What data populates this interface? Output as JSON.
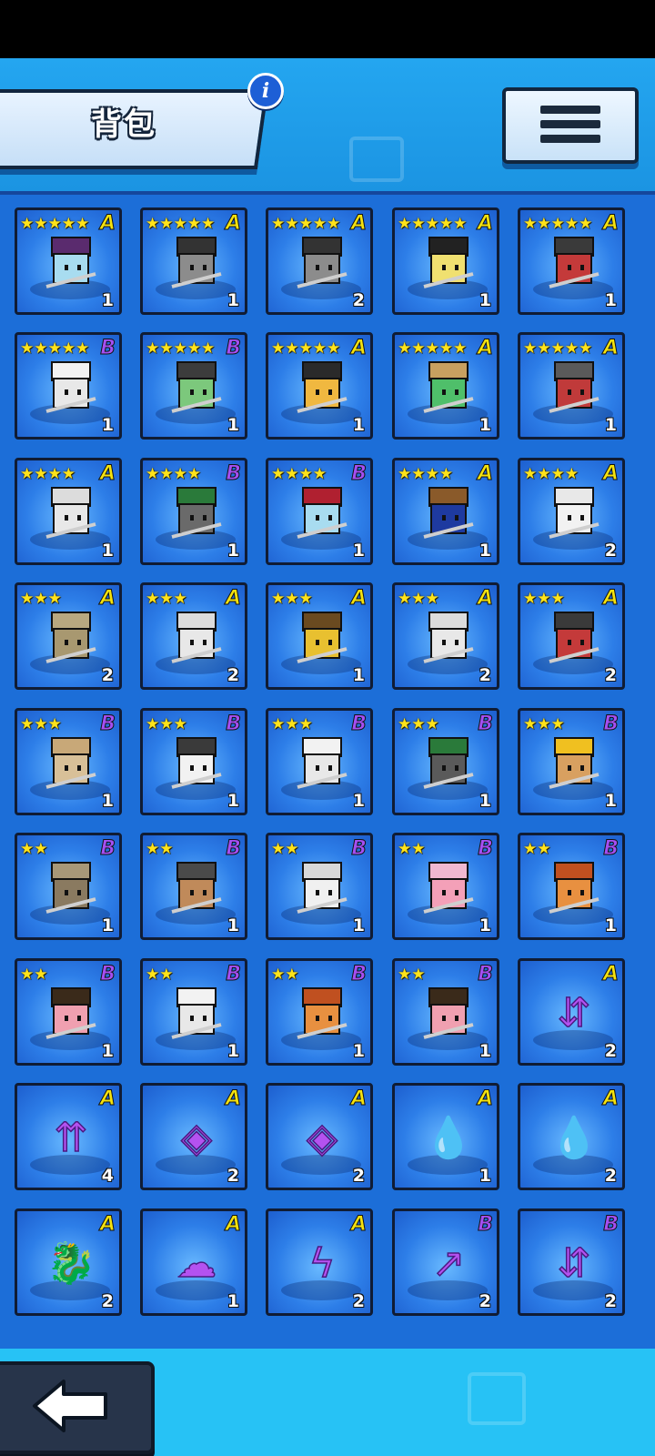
{
  "header": {
    "title": "背包",
    "info_icon": "info-icon",
    "menu_icon": "hamburger-menu-icon"
  },
  "colors": {
    "grade_a": "#f5e20e",
    "grade_b": "#a54ff2",
    "star": "#ffe31a"
  },
  "inventory": [
    {
      "name": "witch-hat-mage",
      "grade": "A",
      "stars": 5,
      "count": "1",
      "kind": "hero",
      "hair": "#5a2b6e",
      "face": "#a8dcf0"
    },
    {
      "name": "gray-block-swordsman",
      "grade": "A",
      "stars": 5,
      "count": "1",
      "kind": "hero",
      "hair": "#333333",
      "face": "#8c8c8c"
    },
    {
      "name": "gray-block-gunner",
      "grade": "A",
      "stars": 5,
      "count": "2",
      "kind": "hero",
      "hair": "#333333",
      "face": "#8c8c8c"
    },
    {
      "name": "yellow-ninja",
      "grade": "A",
      "stars": 5,
      "count": "1",
      "kind": "hero",
      "hair": "#222222",
      "face": "#f0e070"
    },
    {
      "name": "red-masked-ninja",
      "grade": "A",
      "stars": 5,
      "count": "1",
      "kind": "hero",
      "hair": "#3a3a3a",
      "face": "#c43a3a"
    },
    {
      "name": "nurse-syringe",
      "grade": "B",
      "stars": 5,
      "count": "1",
      "kind": "hero",
      "hair": "#f2f2f2",
      "face": "#e8e8e8"
    },
    {
      "name": "green-hat-gunner",
      "grade": "B",
      "stars": 5,
      "count": "1",
      "kind": "hero",
      "hair": "#3c3c3c",
      "face": "#7cc87c"
    },
    {
      "name": "hooded-reaper",
      "grade": "A",
      "stars": 5,
      "count": "1",
      "kind": "hero",
      "hair": "#2a2a2a",
      "face": "#f0b840"
    },
    {
      "name": "straw-hat-monk",
      "grade": "A",
      "stars": 5,
      "count": "1",
      "kind": "hero",
      "hair": "#c8a060",
      "face": "#4fbf6a"
    },
    {
      "name": "horned-axe-warrior",
      "grade": "A",
      "stars": 5,
      "count": "1",
      "kind": "hero",
      "hair": "#5a5a5a",
      "face": "#c03a3a"
    },
    {
      "name": "unicorn-knight",
      "grade": "A",
      "stars": 4,
      "count": "1",
      "kind": "hero",
      "hair": "#dcdcdc",
      "face": "#e8e8e8"
    },
    {
      "name": "green-helmet-gunner",
      "grade": "B",
      "stars": 4,
      "count": "1",
      "kind": "hero",
      "hair": "#2a7a3a",
      "face": "#6a6a6a"
    },
    {
      "name": "red-hat-wizard",
      "grade": "B",
      "stars": 4,
      "count": "1",
      "kind": "hero",
      "hair": "#b02030",
      "face": "#a8dcf0"
    },
    {
      "name": "blue-archer",
      "grade": "A",
      "stars": 4,
      "count": "1",
      "kind": "hero",
      "hair": "#8a5a2a",
      "face": "#1e3aa0"
    },
    {
      "name": "clock-head-mage",
      "grade": "A",
      "stars": 4,
      "count": "2",
      "kind": "hero",
      "hair": "#e8e8e8",
      "face": "#f2f2f2"
    },
    {
      "name": "sand-knight",
      "grade": "A",
      "stars": 3,
      "count": "2",
      "kind": "hero",
      "hair": "#b8a880",
      "face": "#a89870"
    },
    {
      "name": "unicorn-cannon",
      "grade": "A",
      "stars": 3,
      "count": "2",
      "kind": "hero",
      "hair": "#dcdcdc",
      "face": "#e8e8e8"
    },
    {
      "name": "golden-shrine-swordsman",
      "grade": "A",
      "stars": 3,
      "count": "1",
      "kind": "hero",
      "hair": "#6a4a20",
      "face": "#e8c030"
    },
    {
      "name": "unicorn-spearman",
      "grade": "A",
      "stars": 3,
      "count": "2",
      "kind": "hero",
      "hair": "#dcdcdc",
      "face": "#e8e8e8"
    },
    {
      "name": "masked-ninja-2",
      "grade": "A",
      "stars": 3,
      "count": "2",
      "kind": "hero",
      "hair": "#3a3a3a",
      "face": "#c43a3a"
    },
    {
      "name": "box-staff-monk",
      "grade": "B",
      "stars": 3,
      "count": "1",
      "kind": "hero",
      "hair": "#c8a878",
      "face": "#d8c098"
    },
    {
      "name": "horned-goat-warrior",
      "grade": "B",
      "stars": 3,
      "count": "1",
      "kind": "hero",
      "hair": "#3a3a3a",
      "face": "#f2f2f2"
    },
    {
      "name": "nurse-syringe-2",
      "grade": "B",
      "stars": 3,
      "count": "1",
      "kind": "hero",
      "hair": "#f2f2f2",
      "face": "#e8e8e8"
    },
    {
      "name": "green-helmet-gunner-2",
      "grade": "B",
      "stars": 3,
      "count": "1",
      "kind": "hero",
      "hair": "#2a7a3a",
      "face": "#5a5a5a"
    },
    {
      "name": "bee-spearman",
      "grade": "B",
      "stars": 3,
      "count": "1",
      "kind": "hero",
      "hair": "#f0c020",
      "face": "#d8a060"
    },
    {
      "name": "straw-hood-fighter",
      "grade": "B",
      "stars": 2,
      "count": "1",
      "kind": "hero",
      "hair": "#a89878",
      "face": "#8a7a60"
    },
    {
      "name": "wolf-swordsman",
      "grade": "B",
      "stars": 2,
      "count": "1",
      "kind": "hero",
      "hair": "#4a4a4a",
      "face": "#c08a5a"
    },
    {
      "name": "silver-hair-lancer",
      "grade": "B",
      "stars": 2,
      "count": "1",
      "kind": "hero",
      "hair": "#d8d8d8",
      "face": "#f0f0f0"
    },
    {
      "name": "pink-bunny-swordsman",
      "grade": "B",
      "stars": 2,
      "count": "1",
      "kind": "hero",
      "hair": "#f0b8d0",
      "face": "#f4a0b8"
    },
    {
      "name": "monkey-king-staff",
      "grade": "B",
      "stars": 2,
      "count": "1",
      "kind": "hero",
      "hair": "#c05020",
      "face": "#e89040"
    },
    {
      "name": "dragon-crown-warrior",
      "grade": "B",
      "stars": 2,
      "count": "1",
      "kind": "hero",
      "hair": "#3a2a1a",
      "face": "#f0a0b0"
    },
    {
      "name": "nurse-syringe-3",
      "grade": "B",
      "stars": 2,
      "count": "1",
      "kind": "hero",
      "hair": "#f2f2f2",
      "face": "#e8e8e8"
    },
    {
      "name": "monkey-king-staff-2",
      "grade": "B",
      "stars": 2,
      "count": "1",
      "kind": "hero",
      "hair": "#c05020",
      "face": "#e89040"
    },
    {
      "name": "dragon-crown-warrior-2",
      "grade": "B",
      "stars": 2,
      "count": "1",
      "kind": "hero",
      "hair": "#3a2a1a",
      "face": "#f0a0b0"
    },
    {
      "name": "split-arrows-skill",
      "grade": "A",
      "stars": 0,
      "count": "2",
      "kind": "skill",
      "symbol": "⇵"
    },
    {
      "name": "double-up-arrow-skill",
      "grade": "A",
      "stars": 0,
      "count": "4",
      "kind": "skill",
      "symbol": "⇈"
    },
    {
      "name": "triple-shield-skill",
      "grade": "A",
      "stars": 0,
      "count": "2",
      "kind": "skill",
      "symbol": "◈"
    },
    {
      "name": "triple-shield-skill-2",
      "grade": "A",
      "stars": 0,
      "count": "2",
      "kind": "skill",
      "symbol": "◈"
    },
    {
      "name": "sparkle-drop-skill",
      "grade": "A",
      "stars": 0,
      "count": "1",
      "kind": "skill",
      "symbol": "💧"
    },
    {
      "name": "sparkle-drop-skill-2",
      "grade": "A",
      "stars": 0,
      "count": "2",
      "kind": "skill",
      "symbol": "💧"
    },
    {
      "name": "dragon-skill",
      "grade": "A",
      "stars": 0,
      "count": "2",
      "kind": "skill",
      "symbol": "🐉"
    },
    {
      "name": "storm-cloud-skill",
      "grade": "A",
      "stars": 0,
      "count": "1",
      "kind": "skill",
      "symbol": "☁"
    },
    {
      "name": "lightning-skill",
      "grade": "A",
      "stars": 0,
      "count": "2",
      "kind": "skill",
      "symbol": "ϟ"
    },
    {
      "name": "trend-arrow-skill",
      "grade": "B",
      "stars": 0,
      "count": "2",
      "kind": "skill",
      "symbol": "↗"
    },
    {
      "name": "split-arrows-skill-2",
      "grade": "B",
      "stars": 0,
      "count": "2",
      "kind": "skill",
      "symbol": "⇵"
    }
  ],
  "footer": {
    "back_icon": "back-arrow-icon"
  }
}
